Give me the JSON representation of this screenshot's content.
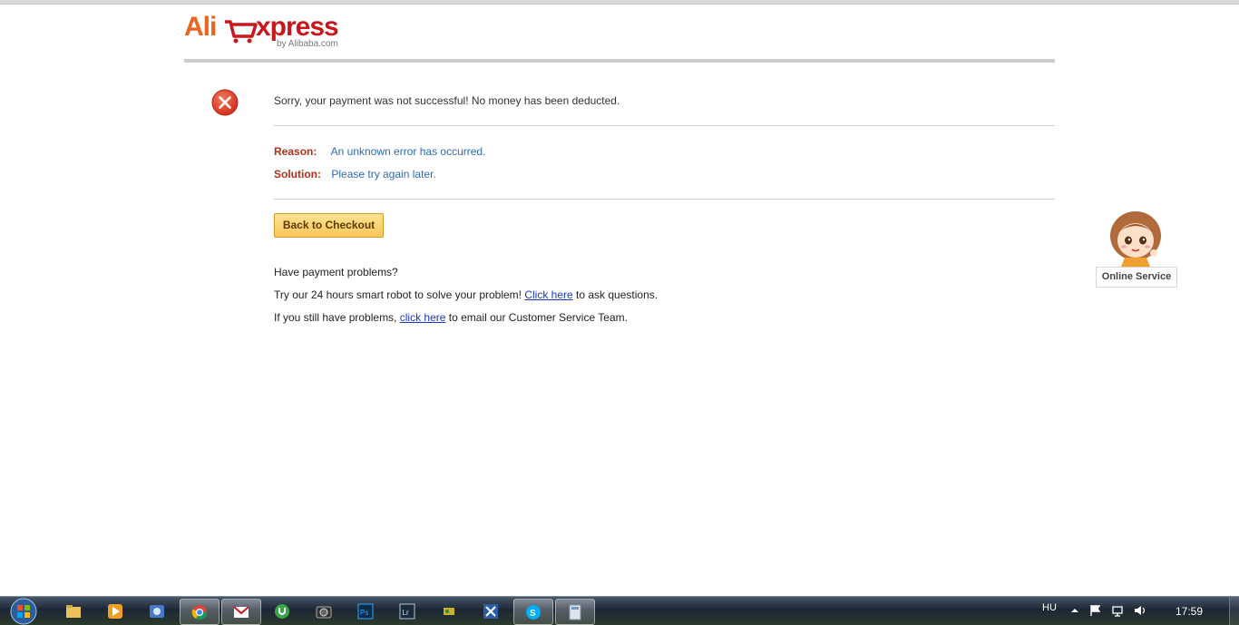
{
  "logo": {
    "part1": "Ali",
    "part2": "xpress",
    "byline": "by Alibaba.com"
  },
  "error": {
    "message": "Sorry, your payment was not successful! No money has been deducted.",
    "reason_label": "Reason:",
    "reason_value": "An unknown error has occurred.",
    "solution_label": "Solution:",
    "solution_value": "Please try again later."
  },
  "actions": {
    "back_label": "Back to Checkout"
  },
  "help": {
    "heading": "Have payment problems?",
    "line2_before": "Try our 24 hours smart robot to solve your problem! ",
    "line2_link": "Click here",
    "line2_after": " to ask questions.",
    "line3_before": "If you still have problems, ",
    "line3_link": "click here",
    "line3_after": " to email our Customer Service Team."
  },
  "online_service": {
    "label": "Online Service"
  },
  "taskbar": {
    "items": [
      "start-orb-icon",
      "explorer-icon",
      "media-player-icon",
      "photo-gallery-icon",
      "chrome-icon",
      "mail-icon",
      "utorrent-icon",
      "camera-icon",
      "photoshop-icon",
      "lightroom-icon",
      "game-icon",
      "excel-icon",
      "skype-icon",
      "calculator-icon"
    ],
    "language": "HU",
    "clock": "17:59"
  },
  "colors": {
    "error_red": "#e0452b",
    "label_red": "#b5301a",
    "value_blue": "#2f6bb5",
    "button_yellow": "#f9c65a"
  }
}
